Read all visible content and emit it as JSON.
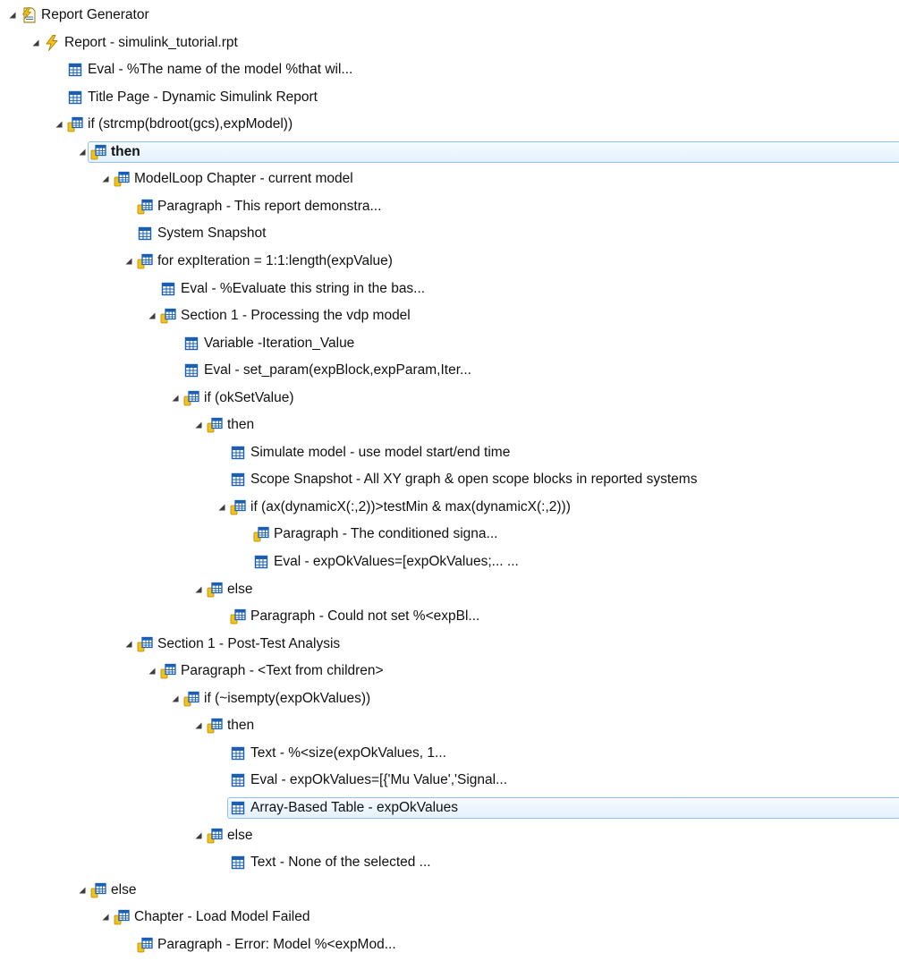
{
  "tree": [
    {
      "label": "Report Generator",
      "depth": 0,
      "expanded": true,
      "icon": "report-generator-icon"
    },
    {
      "label": "Report - simulink_tutorial.rpt",
      "depth": 1,
      "expanded": true,
      "icon": "report-lightning-icon"
    },
    {
      "label": "Eval - %The name of the model %that wil...",
      "depth": 2,
      "expanded": null,
      "icon": "table-component-icon"
    },
    {
      "label": "Title Page - Dynamic Simulink Report",
      "depth": 2,
      "expanded": null,
      "icon": "table-component-icon"
    },
    {
      "label": "if (strcmp(bdroot(gcs),expModel))",
      "depth": 2,
      "expanded": true,
      "icon": "parent-component-icon"
    },
    {
      "label": "then",
      "depth": 3,
      "expanded": true,
      "icon": "parent-component-icon",
      "selected": true,
      "bold": true
    },
    {
      "label": "ModelLoop Chapter - current model",
      "depth": 4,
      "expanded": true,
      "icon": "parent-component-icon"
    },
    {
      "label": "Paragraph - This report demonstra...",
      "depth": 5,
      "expanded": null,
      "icon": "parent-component-icon"
    },
    {
      "label": "System Snapshot",
      "depth": 5,
      "expanded": null,
      "icon": "table-component-icon"
    },
    {
      "label": "for expIteration = 1:1:length(expValue)",
      "depth": 5,
      "expanded": true,
      "icon": "parent-component-icon"
    },
    {
      "label": "Eval - %Evaluate this string in the bas...",
      "depth": 6,
      "expanded": null,
      "icon": "table-component-icon"
    },
    {
      "label": "Section 1 - Processing the vdp model",
      "depth": 6,
      "expanded": true,
      "icon": "parent-component-icon"
    },
    {
      "label": "Variable -Iteration_Value",
      "depth": 7,
      "expanded": null,
      "icon": "table-component-icon"
    },
    {
      "label": "Eval - set_param(expBlock,expParam,Iter...",
      "depth": 7,
      "expanded": null,
      "icon": "table-component-icon"
    },
    {
      "label": "if (okSetValue)",
      "depth": 7,
      "expanded": true,
      "icon": "parent-component-icon"
    },
    {
      "label": "then",
      "depth": 8,
      "expanded": true,
      "icon": "parent-component-icon"
    },
    {
      "label": "Simulate model - use model start/end time",
      "depth": 9,
      "expanded": null,
      "icon": "table-component-icon"
    },
    {
      "label": "Scope Snapshot - All XY graph & open scope blocks in reported systems",
      "depth": 9,
      "expanded": null,
      "icon": "table-component-icon"
    },
    {
      "label": "if (ax(dynamicX(:,2))>testMin & max(dynamicX(:,2)))",
      "depth": 9,
      "expanded": true,
      "icon": "parent-component-icon"
    },
    {
      "label": "Paragraph - The conditioned signa...",
      "depth": 10,
      "expanded": null,
      "icon": "parent-component-icon"
    },
    {
      "label": "Eval - expOkValues=[expOkValues;...    ...",
      "depth": 10,
      "expanded": null,
      "icon": "table-component-icon"
    },
    {
      "label": "else",
      "depth": 8,
      "expanded": true,
      "icon": "parent-component-icon"
    },
    {
      "label": "Paragraph - Could not set %<expBl...",
      "depth": 9,
      "expanded": null,
      "icon": "parent-component-icon"
    },
    {
      "label": "Section 1 - Post-Test Analysis",
      "depth": 5,
      "expanded": true,
      "icon": "parent-component-icon"
    },
    {
      "label": "Paragraph - <Text from children>",
      "depth": 6,
      "expanded": true,
      "icon": "parent-component-icon"
    },
    {
      "label": "if (~isempty(expOkValues))",
      "depth": 7,
      "expanded": true,
      "icon": "parent-component-icon"
    },
    {
      "label": "then",
      "depth": 8,
      "expanded": true,
      "icon": "parent-component-icon"
    },
    {
      "label": "Text - %<size(expOkValues, 1...",
      "depth": 9,
      "expanded": null,
      "icon": "table-component-icon"
    },
    {
      "label": "Eval - expOkValues=[{'Mu Value','Signal...",
      "depth": 9,
      "expanded": null,
      "icon": "table-component-icon"
    },
    {
      "label": "Array-Based Table - expOkValues",
      "depth": 9,
      "expanded": null,
      "icon": "table-component-icon",
      "selected": true
    },
    {
      "label": "else",
      "depth": 8,
      "expanded": true,
      "icon": "parent-component-icon"
    },
    {
      "label": "Text - None of the selected ...",
      "depth": 9,
      "expanded": null,
      "icon": "table-component-icon"
    },
    {
      "label": "else",
      "depth": 3,
      "expanded": true,
      "icon": "parent-component-icon"
    },
    {
      "label": "Chapter - Load Model Failed",
      "depth": 4,
      "expanded": true,
      "icon": "parent-component-icon"
    },
    {
      "label": "Paragraph - Error: Model %<expMod...",
      "depth": 5,
      "expanded": null,
      "icon": "parent-component-icon"
    }
  ],
  "colors": {
    "selection_border": "#8fc0ef",
    "selection_fill": "#e4f1fd",
    "expander": "#3b3b3b",
    "icon_blue": "#1a5fb4",
    "icon_yellow": "#f2c21b"
  }
}
